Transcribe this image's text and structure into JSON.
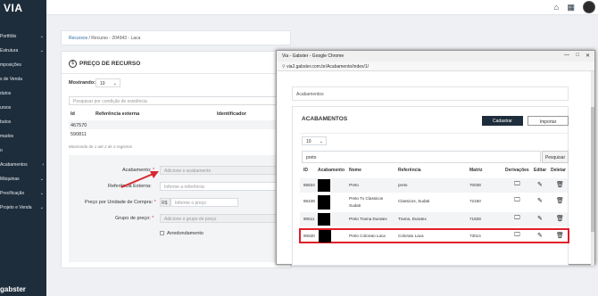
{
  "sidebar": {
    "logo": "VIA",
    "items": [
      {
        "label": "Portfólio",
        "chevron": "⌄"
      },
      {
        "label": "Estrutura",
        "chevron": "⌄"
      },
      {
        "label": "mposições"
      },
      {
        "label": "s de Venda"
      },
      {
        "label": "dutos"
      },
      {
        "label": "ursos"
      },
      {
        "label": "butos"
      },
      {
        "label": "mados"
      },
      {
        "label": "o"
      },
      {
        "label": "Acabamentos",
        "chevron": "›"
      },
      {
        "label": "Máquinas",
        "chevron": "⌄"
      },
      {
        "label": "Precificação",
        "chevron": "⌄"
      },
      {
        "label": "Projeto e Venda",
        "chevron": "⌄"
      }
    ],
    "footer": "gabster"
  },
  "topbar": {
    "home_icon": "⌂",
    "grid_icon": "▦"
  },
  "breadcrumb": {
    "root": "Recursos",
    "sep": "/",
    "current": "Recurso - 204943 - Laca"
  },
  "resource": {
    "title": "PREÇO DE RECURSO",
    "title_icon": "$",
    "showing_label": "Mostrando:",
    "showing_value": "10",
    "search_placeholder": "Pesquisar por condição de existência",
    "columns": [
      "Id",
      "Referência externa",
      "Identificador"
    ],
    "rows": [
      [
        "467570"
      ],
      [
        "590811"
      ]
    ],
    "footer_text": "Mostrando de 1 até 2 de 2 registros",
    "form": {
      "acabamento_label": "Acabamento:",
      "acabamento_placeholder": "Adicione o acabamento",
      "ref_label": "Referência Externa:",
      "ref_placeholder": "Informe a referência",
      "preco_label": "Preço por Unidade de Compra:",
      "currency": "R$",
      "preco_placeholder": "Informe o preço",
      "grupo_label": "Grupo de preço:",
      "grupo_placeholder": "Adicione o grupo de preço",
      "arredondamento_label": "Arredondamento",
      "required": "*"
    }
  },
  "browser": {
    "title": "Via - Gabster - Google Chrome",
    "url": "via2.gabster.com.br/Acabamento/index/1/",
    "controls": [
      "—",
      "□",
      "✕"
    ]
  },
  "acabamentos": {
    "breadcrumb": "Acabamentos",
    "title": "ACABAMENTOS",
    "cadastrar": "Cadastrar",
    "importar": "Importar",
    "page_size": "10",
    "search_value": "preto",
    "search_button": "Pesquisar",
    "columns": [
      "ID",
      "Acabamento",
      "Nome",
      "Referência",
      "Matriz",
      "Derivações",
      "Editar",
      "Deletar"
    ],
    "rows": [
      {
        "id": "86834",
        "nome": "Preto",
        "nome2": "",
        "ref": "preto",
        "matriz": "70038"
      },
      {
        "id": "86438",
        "nome": "Preto Tx Classicos",
        "nome2": "Sudati",
        "ref": "Classicos, Sudati",
        "matriz": "72150"
      },
      {
        "id": "90511",
        "nome": "Preto Trama Duratex",
        "nome2": "",
        "ref": "Trama, Duratex",
        "matriz": "71828"
      },
      {
        "id": "90630",
        "nome": "Preto Colorato Laca",
        "nome2": "",
        "ref": "Colorato Laca",
        "matriz": "73014"
      }
    ],
    "highlight_color": "#e01e2b"
  }
}
